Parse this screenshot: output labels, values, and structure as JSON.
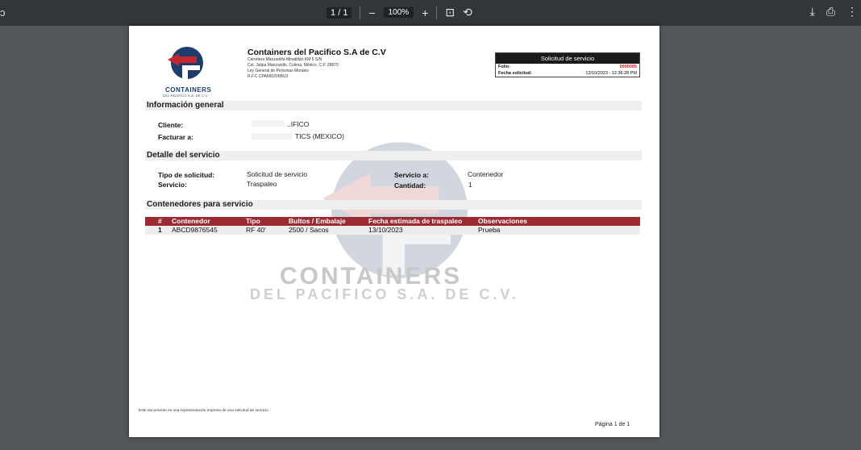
{
  "toolbar": {
    "left_glyph": "ↄ",
    "page_current": "1",
    "page_sep": "/",
    "page_total": "1",
    "zoom_out": "−",
    "zoom": "100%",
    "zoom_in": "+",
    "fit_icon": "⊡",
    "rotate_icon": "⟲",
    "download_icon": "⤓",
    "print_icon": "⎙",
    "menu_icon": "⋮"
  },
  "header": {
    "company_name": "Containers del Pacifico S.A de C.V",
    "address1": "Carretera Manzanillo-Minatitlán KM 5 S/N",
    "address2": "Col. Jalipa Manzanillo, Colima, México, C.P. 28870",
    "regime": "Ley General de Personas Morales",
    "rfc": "R.F.C CPA990206BU3",
    "logo_line1": "CONTAINERS",
    "logo_line2": "DEL PACIFICO S.A. DE C.V."
  },
  "request_box": {
    "title": "Solicitud de servicio",
    "folio_label": "Folio:",
    "folio_value": "0000005",
    "date_label": "Fecha solicitud:",
    "date_value": "12/10/2023 - 12:36:28 PM"
  },
  "general": {
    "section_title": "Información general",
    "client_label": "Cliente:",
    "client_value": "..IFICO",
    "invoice_label": "Facturar a:",
    "invoice_value": "TICS (MEXICO)"
  },
  "detail": {
    "section_title": "Detalle del servicio",
    "type_label": "Tipo de solicitud:",
    "type_value": "Solicitud de servicio",
    "service_label": "Servicio:",
    "service_value": "Traspaleo",
    "service_to_label": "Servicio a:",
    "service_to_value": "Contenedor",
    "qty_label": "Cantidad:",
    "qty_value": "1"
  },
  "containers": {
    "section_title": "Contenedores para servicio",
    "headers": [
      "#",
      "Contenedor",
      "Tipo",
      "Bultos / Embalaje",
      "Fecha estimada de traspaleo",
      "Observaciones"
    ],
    "rows": [
      [
        "1",
        "ABCD9876545",
        "RF 40'",
        "2500 / Sacos",
        "13/10/2023",
        "Prueba"
      ]
    ]
  },
  "watermark": {
    "line1": "CONTAINERS",
    "line2": "DEL PACIFICO S.A. DE C.V."
  },
  "footer": {
    "note": "Este documento es una representación impresa de una solicitud de servicio",
    "page": "Página 1 de 1"
  },
  "colors": {
    "toolbar": "#323639",
    "viewer_bg": "#525659",
    "table_header": "#9b2a33",
    "brand_blue": "#1d3b6b",
    "brand_red": "#c4262e",
    "folio_red": "#e0161b"
  }
}
